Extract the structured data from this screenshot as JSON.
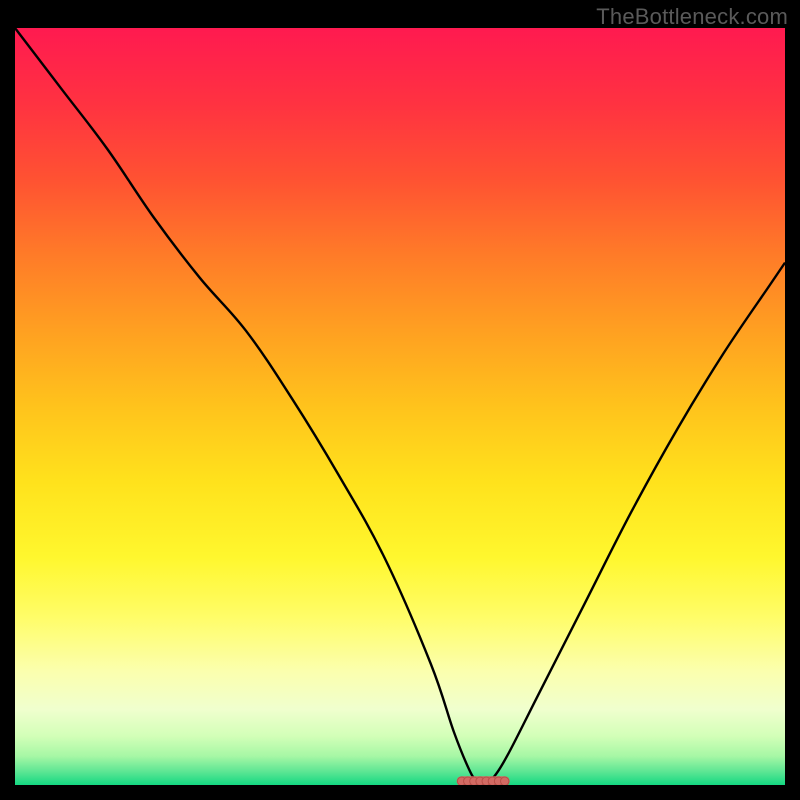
{
  "watermark": "TheBottleneck.com",
  "colors": {
    "black": "#000000",
    "curve": "#000000",
    "marker_fill": "#d26a63",
    "marker_stroke": "#b84f48"
  },
  "chart_data": {
    "type": "line",
    "title": "",
    "xlabel": "",
    "ylabel": "",
    "xlim": [
      0,
      100
    ],
    "ylim": [
      0,
      100
    ],
    "grid": false,
    "legend": false,
    "background_gradient": {
      "stops": [
        {
          "offset": 0.0,
          "color": "#ff1a50"
        },
        {
          "offset": 0.1,
          "color": "#ff3241"
        },
        {
          "offset": 0.2,
          "color": "#ff5232"
        },
        {
          "offset": 0.3,
          "color": "#ff7b28"
        },
        {
          "offset": 0.4,
          "color": "#ffa021"
        },
        {
          "offset": 0.5,
          "color": "#ffc31c"
        },
        {
          "offset": 0.6,
          "color": "#ffe21c"
        },
        {
          "offset": 0.7,
          "color": "#fff72e"
        },
        {
          "offset": 0.78,
          "color": "#fffd6a"
        },
        {
          "offset": 0.85,
          "color": "#fbffae"
        },
        {
          "offset": 0.9,
          "color": "#f0ffce"
        },
        {
          "offset": 0.935,
          "color": "#d3ffb8"
        },
        {
          "offset": 0.962,
          "color": "#a6f7a5"
        },
        {
          "offset": 0.982,
          "color": "#5ee694"
        },
        {
          "offset": 1.0,
          "color": "#14d882"
        }
      ]
    },
    "series": [
      {
        "name": "bottleneck-curve",
        "x": [
          0,
          6,
          12,
          18,
          24,
          30,
          36,
          42,
          48,
          54,
          57,
          59,
          60,
          61,
          62,
          64,
          68,
          74,
          80,
          86,
          92,
          98,
          100
        ],
        "values": [
          100,
          92,
          84,
          75,
          67,
          60,
          51,
          41,
          30,
          16,
          7,
          2,
          0.5,
          0,
          0.8,
          4,
          12,
          24,
          36,
          47,
          57,
          66,
          69
        ]
      }
    ],
    "markers": {
      "name": "target-range",
      "y": 0.5,
      "x": [
        58.0,
        58.8,
        59.6,
        60.4,
        61.2,
        62.0,
        62.8,
        63.6
      ]
    }
  }
}
